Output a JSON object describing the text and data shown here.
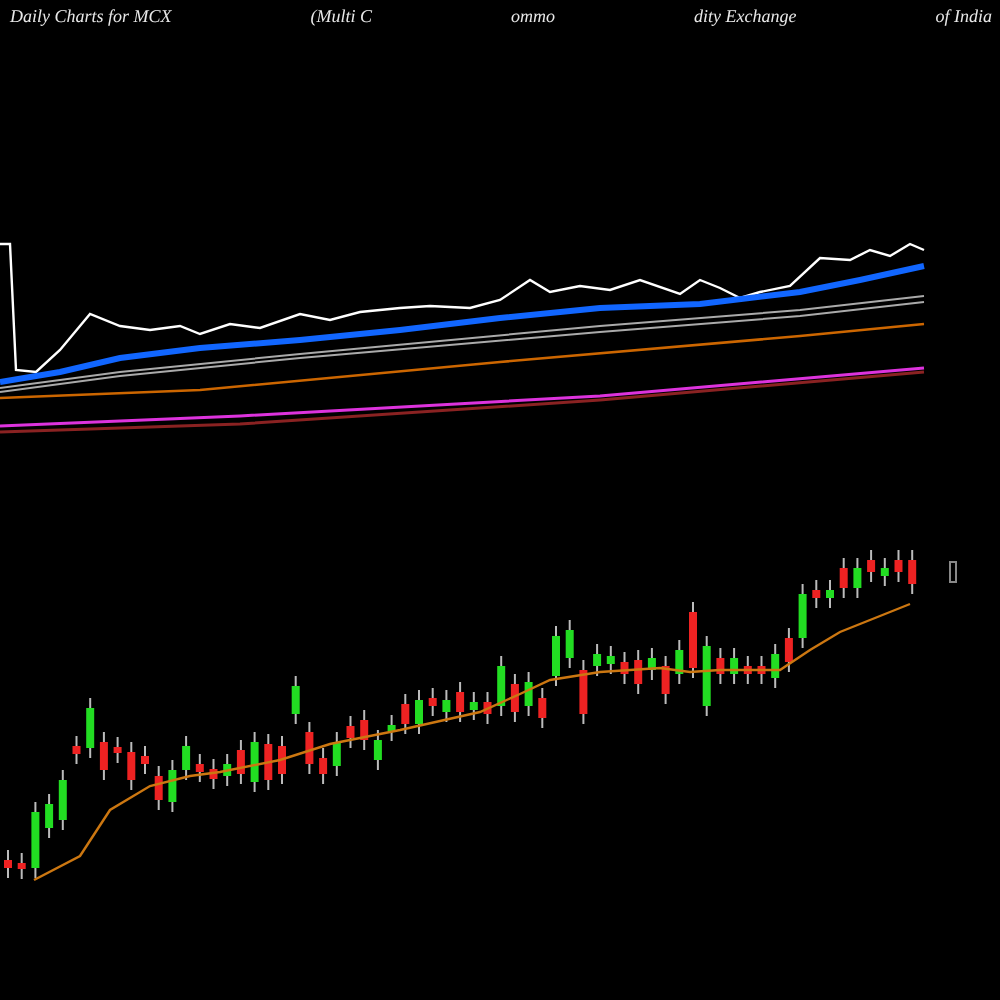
{
  "header": {
    "title_parts": [
      "Daily Charts for MCX",
      "(Multi  C",
      "ommo",
      "dity Exchange",
      "of  India"
    ]
  }
}
